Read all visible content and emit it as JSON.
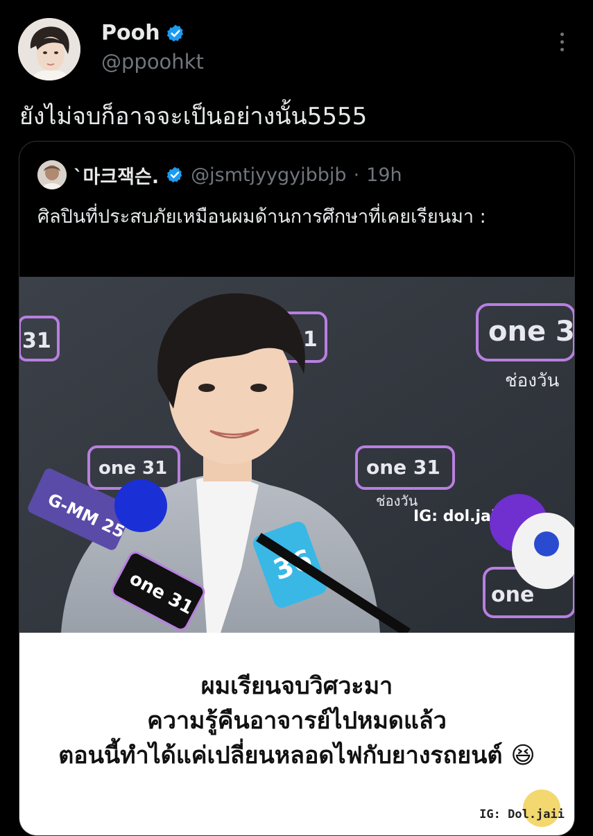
{
  "author": {
    "display_name": "Pooh",
    "handle": "@ppoohkt",
    "verified": true,
    "verified_color": "#1d9bf0",
    "avatar_icon": "profile-photo"
  },
  "tweet": {
    "text": "ยังไม่จบก็อาจจะเป็นอย่างนั้น5555"
  },
  "quoted": {
    "display_name": "`마크잭슨.",
    "handle": "@jsmtjyygyjbbjb",
    "separator": "·",
    "time": "19h",
    "text": "ศิลปินที่ประสบภัยเหมือนผมด้านการศึกษาที่เคยเรียนมา :",
    "media": {
      "watermark": "IG: dol.jaii",
      "backdrop_logo": "one 31",
      "backdrop_sub": "ช่องวัน",
      "mic_labels": [
        "G-MM 25",
        "one 31",
        "36"
      ],
      "caption_lines": [
        "ผมเรียนจบวิศวะมา",
        "ความรู้คืนอาจารย์ไปหมดแล้ว",
        "ตอนนี้ทำได้แค่เปลี่ยนหลอดไฟกับยางรถยนต์ 😆"
      ],
      "caption_watermark": "IG: Dol.jaii"
    }
  }
}
